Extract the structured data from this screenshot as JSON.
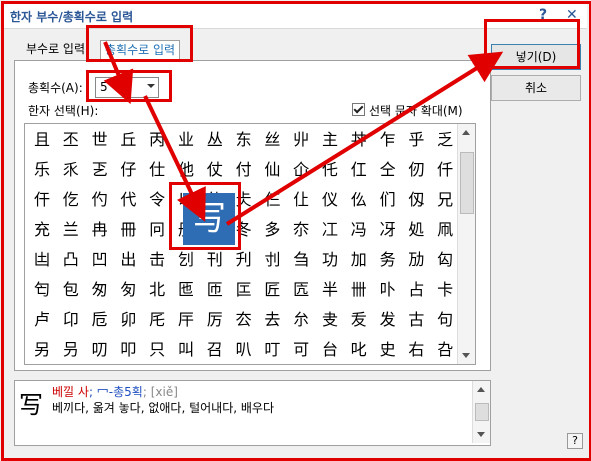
{
  "window": {
    "title": "한자 부수/총획수로 입력",
    "help_glyph": "?",
    "close_glyph": "✕"
  },
  "tabs": [
    {
      "label": "부수로 입력",
      "active": false
    },
    {
      "label": "총획수로 입력",
      "active": true
    }
  ],
  "stroke_count": {
    "label": "총획수(A):",
    "value": "5"
  },
  "hanja_select": {
    "label": "한자 선택(H):"
  },
  "enlarge_option": {
    "label": "선택 문자 확대(M)",
    "checked": true
  },
  "buttons": {
    "insert": "넣기(D)",
    "cancel": "취소"
  },
  "characters": [
    [
      "且",
      "丕",
      "世",
      "丘",
      "丙",
      "业",
      "丛",
      "东",
      "丝",
      "丱",
      "主",
      "丼",
      "乍",
      "乎",
      "乏"
    ],
    [
      "乐",
      "乑",
      "乤",
      "仔",
      "仕",
      "他",
      "仗",
      "付",
      "仙",
      "仚",
      "仛",
      "仜",
      "仝",
      "仞",
      "仟"
    ],
    [
      "仠",
      "仡",
      "仢",
      "代",
      "令",
      "以",
      "仦",
      "仧",
      "仨",
      "仩",
      "仪",
      "仫",
      "们",
      "仭",
      "兄"
    ],
    [
      "充",
      "兰",
      "冉",
      "冊",
      "冋",
      "册",
      "写",
      "冬",
      "多",
      "夵",
      "冮",
      "冯",
      "冴",
      "処",
      "凧"
    ],
    [
      "凷",
      "凸",
      "凹",
      "出",
      "击",
      "刉",
      "刊",
      "刋",
      "刌",
      "刍",
      "功",
      "加",
      "务",
      "劢",
      "匃"
    ],
    [
      "匄",
      "包",
      "匆",
      "匇",
      "北",
      "匜",
      "匝",
      "匞",
      "匠",
      "匟",
      "半",
      "卌",
      "卟",
      "占",
      "卡"
    ],
    [
      "卢",
      "卬",
      "卮",
      "卯",
      "厇",
      "厈",
      "厉",
      "厺",
      "去",
      "厼",
      "叏",
      "叐",
      "发",
      "古",
      "句"
    ],
    [
      "另",
      "叧",
      "叨",
      "叩",
      "只",
      "叫",
      "召",
      "叭",
      "叮",
      "可",
      "台",
      "叱",
      "史",
      "右",
      "叴"
    ]
  ],
  "selected_char": "写",
  "info": {
    "char": "写",
    "meaning": "베낄 사",
    "sep": ";",
    "radical": " 冖-총5획",
    "pinyin": "; [xiě]",
    "definition": "베끼다, 옮겨 놓다, 없애다, 털어내다, 배우다"
  },
  "colors": {
    "accent": "#2e6db4",
    "annotation": "#e00000",
    "meaning": "#cc0000",
    "radical": "#1f4fbf"
  }
}
